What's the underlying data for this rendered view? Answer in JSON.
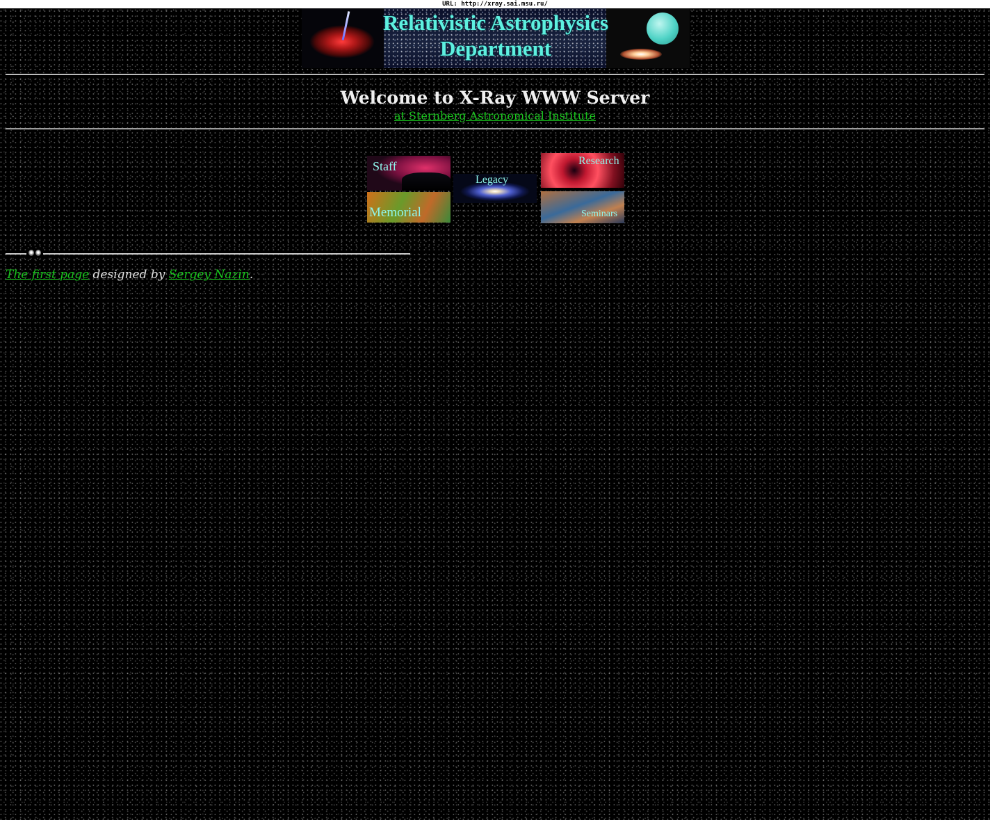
{
  "url_bar": {
    "text": "URL: http://xray.sai.msu.ru/"
  },
  "banner": {
    "title_line1": "Relativistic Astrophysics",
    "title_line2": "Department"
  },
  "header": {
    "welcome": "Welcome to X-Ray WWW Server",
    "institute_link": "at Sternberg Astronomical Institute"
  },
  "nav": {
    "staff": "Staff",
    "legacy": "Legacy",
    "research": "Research",
    "memorial": "Memorial",
    "seminars": "Seminars"
  },
  "footer": {
    "first_page_link": "The first page",
    "designed_by": " designed by ",
    "author_link": "Sergey Nazin",
    "period": "."
  },
  "colors": {
    "background": "#000000",
    "link": "#19c41d",
    "banner_text": "#5ef0e0",
    "text": "#e6e6e6"
  }
}
